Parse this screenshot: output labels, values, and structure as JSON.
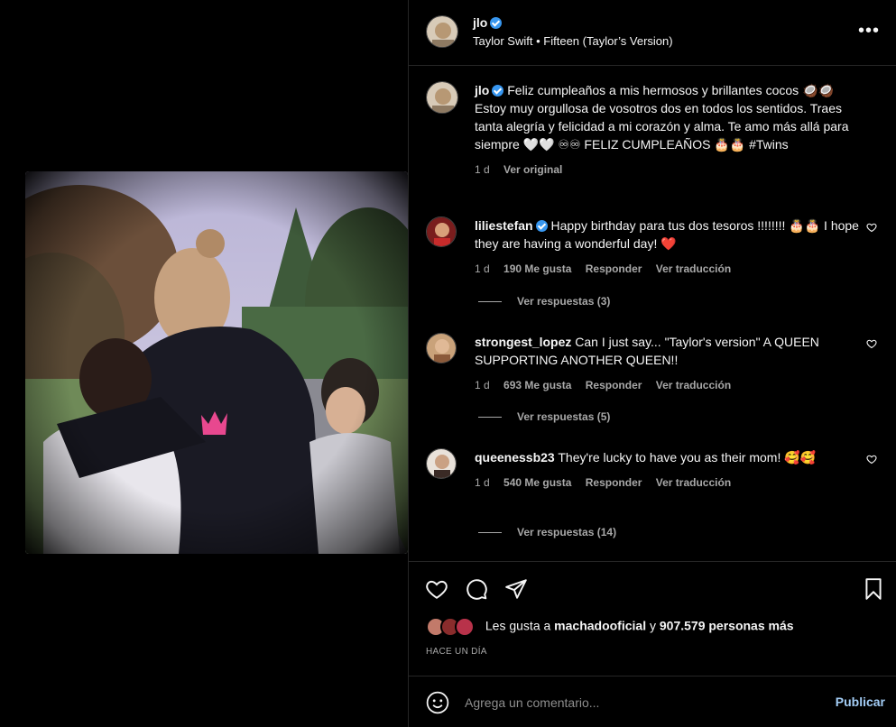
{
  "post": {
    "username": "jlo",
    "audio": "Taylor Swift",
    "audio_sep": "•",
    "audio_track": "Fifteen (Taylor’s Version)",
    "more_icon": "more-dots-icon"
  },
  "caption": {
    "username": "jlo",
    "text": "Feliz cumpleaños a mis hermosos y brillantes cocos 🥥🥥 Estoy muy orgullosa de vosotros dos en todos los sentidos. Traes tanta alegría y felicidad a mi corazón y alma. Te amo más allá para siempre 🤍🤍 ♾♾ FELIZ CUMPLEAÑOS 🎂🎂 #Twins",
    "time": "1 d",
    "see_original": "Ver original"
  },
  "comments": [
    {
      "username": "liliestefan",
      "verified": true,
      "text": "Happy birthday para tus dos tesoros !!!!!!!! 🎂🎂 I hope they are having a wonderful day! ❤️",
      "time": "1 d",
      "likes": "190 Me gusta",
      "reply": "Responder",
      "translate": "Ver traducción",
      "replies": "Ver respuestas (3)"
    },
    {
      "username": "strongest_lopez",
      "verified": false,
      "text": "Can I just say... \"Taylor's version\" A QUEEN SUPPORTING ANOTHER QUEEN!!",
      "time": "1 d",
      "likes": "693 Me gusta",
      "reply": "Responder",
      "translate": "Ver traducción",
      "replies": "Ver respuestas (5)"
    },
    {
      "username": "queenessb23",
      "verified": false,
      "text": "They're lucky to have you as their mom! 🥰🥰",
      "time": "1 d",
      "likes": "540 Me gusta",
      "reply": "Responder",
      "translate": "Ver traducción",
      "replies": "Ver respuestas (14)"
    }
  ],
  "likes": {
    "prefix": "Les gusta a",
    "user": "machadooficial",
    "middle": "y",
    "count": "907.579 personas más"
  },
  "time_ago": "HACE UN DÍA",
  "composer": {
    "placeholder": "Agrega un comentario...",
    "publish": "Publicar"
  },
  "colors": {
    "verified": "#3897f0",
    "publish": "#a3cdf6",
    "heart_red": "#e0245e"
  }
}
